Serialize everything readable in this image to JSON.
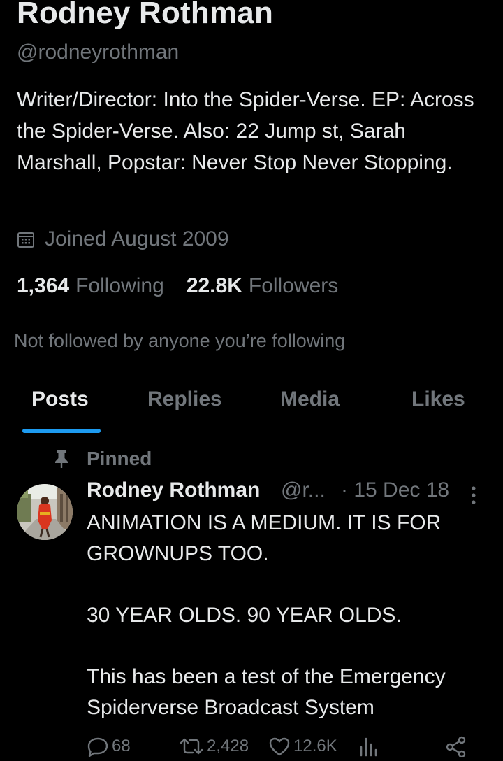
{
  "profile": {
    "name": "Rodney Rothman",
    "handle": "@rodneyrothman",
    "bio": "Writer/Director: Into the Spider-Verse. EP: Across the Spider-Verse. Also:  22 Jump st, Sarah Marshall, Popstar: Never Stop Never Stopping.",
    "joined": "Joined August 2009",
    "following_count": "1,364",
    "following_label": "Following",
    "followers_count": "22.8K",
    "followers_label": "Followers",
    "not_followed_text": "Not followed by anyone you’re following"
  },
  "tabs": {
    "posts": "Posts",
    "replies": "Replies",
    "media": "Media",
    "likes": "Likes",
    "active": "posts"
  },
  "pinned_post": {
    "pinned_label": "Pinned",
    "author_name": "Rodney Rothman",
    "author_handle": "@r...",
    "date": "· 15 Dec 18",
    "text": "ANIMATION IS A MEDIUM. IT IS FOR GROWNUPS TOO.\n\n30 YEAR OLDS. 90 YEAR OLDS.\n\nThis has been a test of the Emergency Spiderverse Broadcast System",
    "replies": "68",
    "reposts": "2,428",
    "likes": "12.6K"
  },
  "icons": {
    "calendar": "calendar-icon",
    "pin": "pin-icon",
    "more": "more-vertical-icon",
    "reply": "reply-icon",
    "repost": "repost-icon",
    "like": "heart-icon",
    "views": "views-icon",
    "share": "share-icon"
  },
  "colors": {
    "background": "#000000",
    "primary_text": "#e7e9ea",
    "secondary_text": "#71767b",
    "accent": "#1d9bf0",
    "divider": "#2f3336"
  }
}
